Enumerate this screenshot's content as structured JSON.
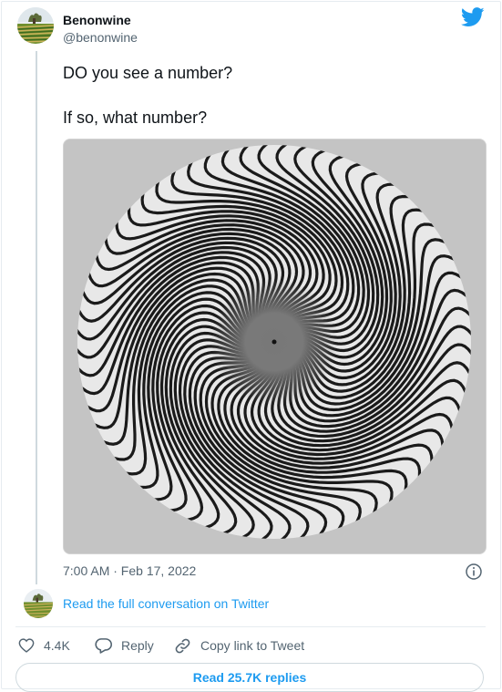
{
  "tweet": {
    "display_name": "Benonwine",
    "handle": "@benonwine",
    "text_line1": "DO you see a number?",
    "text_line2": "If so, what number?",
    "timestamp": "7:00 AM · Feb 17, 2022",
    "media_alt": "Black and white spiral optical illusion circle"
  },
  "conversation": {
    "link_label": "Read the full conversation on Twitter"
  },
  "actions": {
    "like_count": "4.4K",
    "reply_label": "Reply",
    "copy_label": "Copy link to Tweet"
  },
  "footer": {
    "read_replies_label": "Read 25.7K replies"
  },
  "colors": {
    "twitter_blue": "#1d9bf0",
    "muted_text": "#536471",
    "border": "#e6ecf0"
  },
  "icons": {
    "brand": "twitter-bird-icon",
    "info": "info-icon",
    "like": "heart-icon",
    "reply": "speech-bubble-icon",
    "copy": "link-icon"
  }
}
